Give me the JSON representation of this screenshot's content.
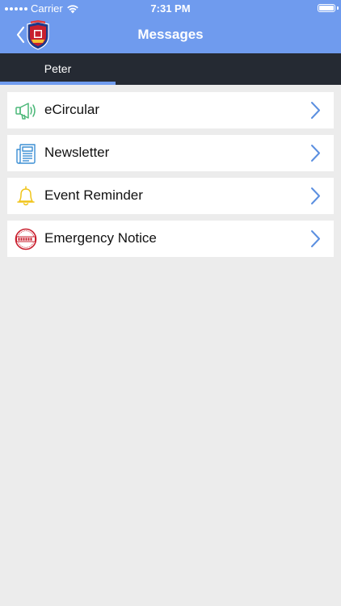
{
  "status_bar": {
    "carrier": "Carrier",
    "time": "7:31 PM"
  },
  "nav": {
    "title": "Messages",
    "back_icon": "chevron-left-icon",
    "logo_icon": "school-crest-logo"
  },
  "tabs": [
    {
      "label": "Peter",
      "selected": true
    }
  ],
  "messages": [
    {
      "label": "eCircular",
      "icon": "megaphone-icon"
    },
    {
      "label": "Newsletter",
      "icon": "newspaper-icon"
    },
    {
      "label": "Event Reminder",
      "icon": "bell-icon"
    },
    {
      "label": "Emergency Notice",
      "icon": "urgent-stamp-icon"
    }
  ],
  "colors": {
    "accent": "#6f9bee",
    "tab_bar": "#252a33",
    "background": "#ececec",
    "chevron": "#5b8fe0",
    "megaphone": "#4cb879",
    "newspaper": "#3b8fd4",
    "bell": "#f0c419",
    "urgent": "#c9202f"
  }
}
